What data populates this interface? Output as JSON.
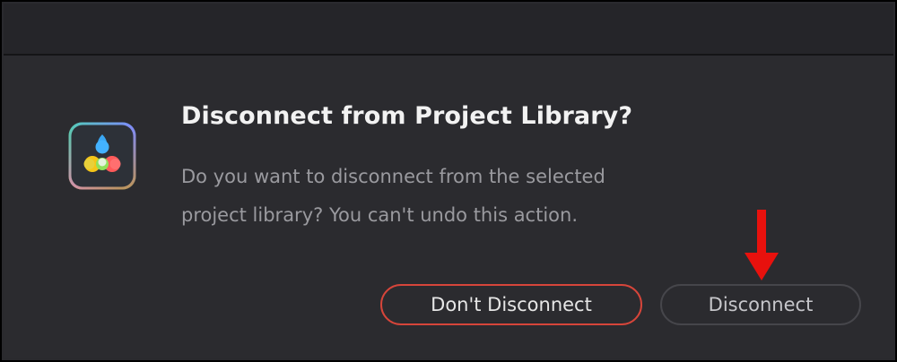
{
  "dialog": {
    "title": "Disconnect from Project Library?",
    "message_line1": "Do you want to disconnect from the selected",
    "message_line2": "project library? You can't undo this action.",
    "app_icon": "davinci-resolve-icon"
  },
  "buttons": {
    "dont_disconnect_label": "Don't Disconnect",
    "disconnect_label": "Disconnect"
  },
  "annotation": {
    "arrow_color": "#e8110d"
  },
  "colors": {
    "dont_disconnect_border": "#d6453a",
    "disconnect_border": "#46464b",
    "dialog_background": "#2b2b2f"
  }
}
